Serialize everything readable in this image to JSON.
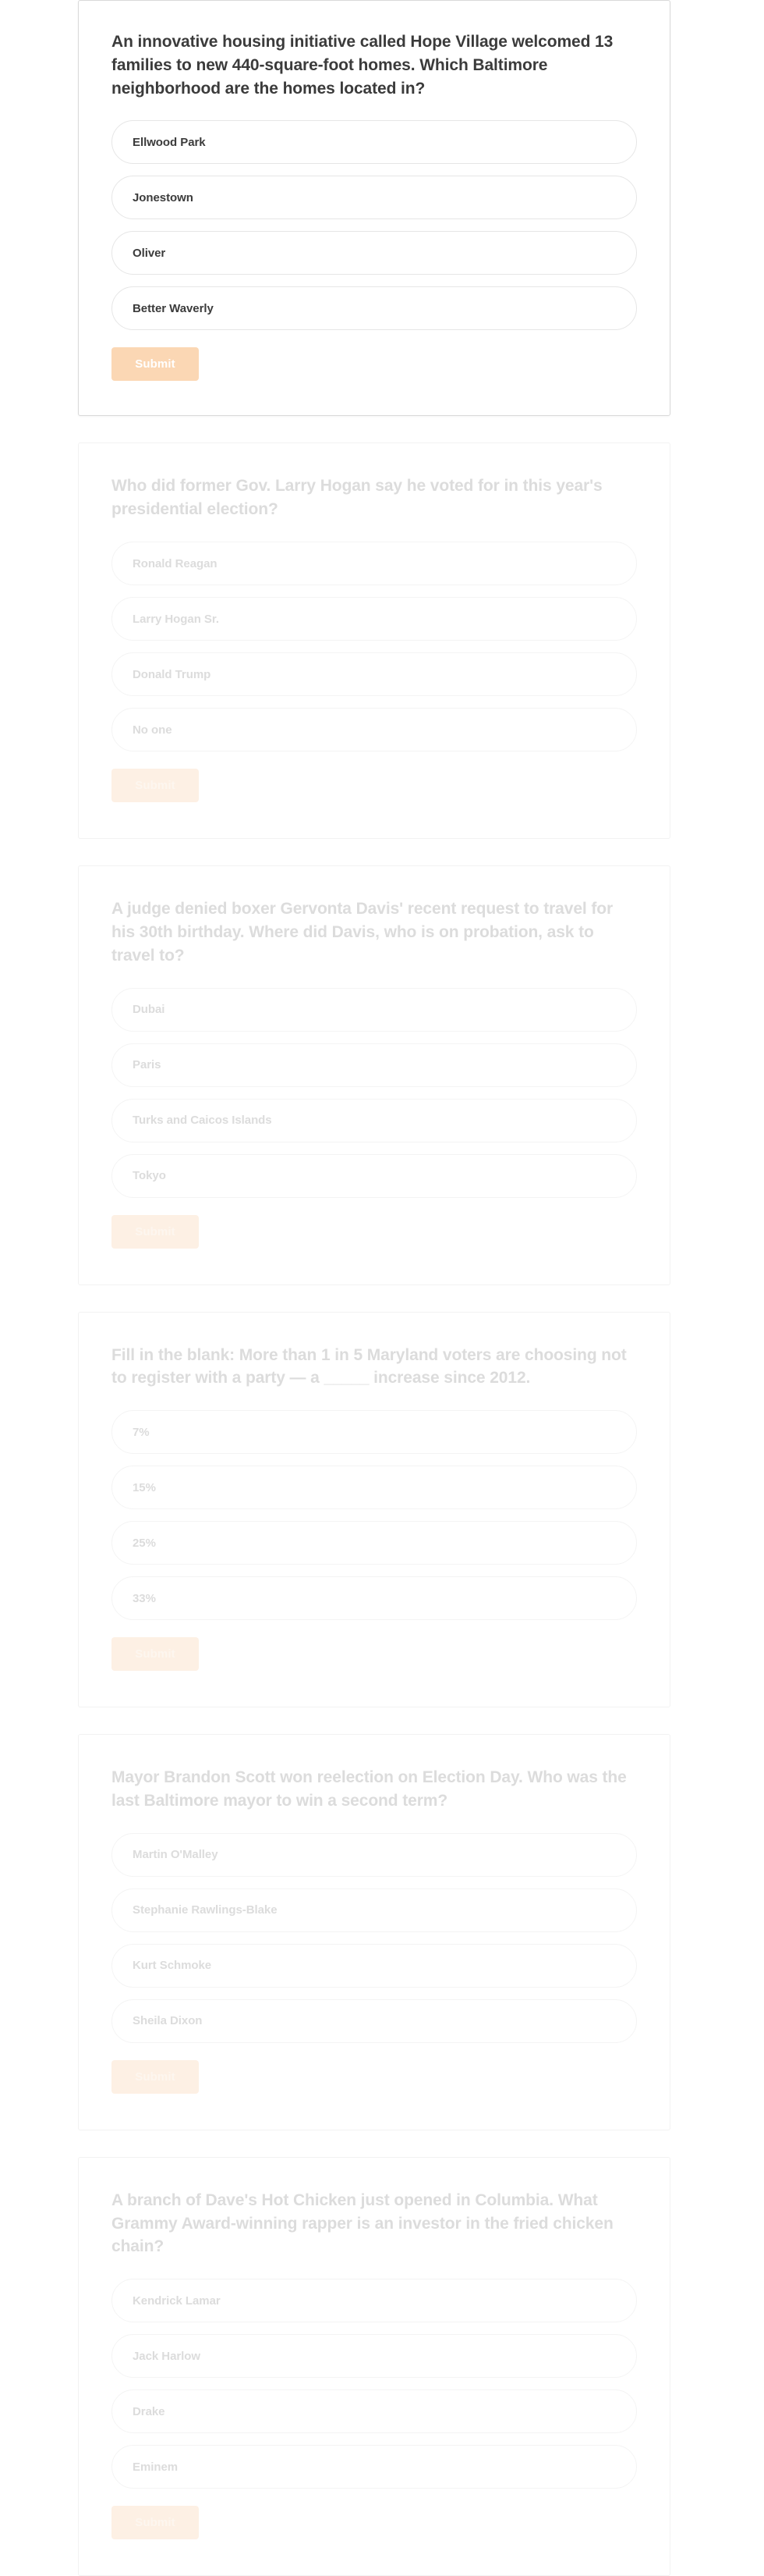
{
  "theme": {
    "page_background": "#ffffff",
    "card_background": "#ffffff",
    "card_border": "#e3e3e3",
    "question_color_active": "#3b3b3b",
    "question_color_faded": "#dcdcdc",
    "option_border_active": "#e6e6e6",
    "option_border_faded": "#f4f4f4",
    "submit_background_active": "#fbd7b4",
    "submit_background_faded": "#fdf0e4",
    "submit_text_color": "#ffffff"
  },
  "submit_label": "Submit",
  "questions": [
    {
      "id": "q1",
      "state": "active",
      "question": "An innovative housing initiative called Hope Village welcomed 13 families to new 440-square-foot homes. Which Baltimore neighborhood are the homes located in?",
      "options": [
        "Ellwood Park",
        "Jonestown",
        "Oliver",
        "Better Waverly"
      ],
      "submit_label": "Submit"
    },
    {
      "id": "q2",
      "state": "faded",
      "question": "Who did former Gov. Larry Hogan say he voted for in this year's presidential election?",
      "options": [
        "Ronald Reagan",
        "Larry Hogan Sr.",
        "Donald Trump",
        "No one"
      ],
      "submit_label": "Submit"
    },
    {
      "id": "q3",
      "state": "faded",
      "question": "A judge denied boxer Gervonta Davis' recent request to travel for his 30th birthday. Where did Davis, who is on probation, ask to travel to?",
      "options": [
        "Dubai",
        "Paris",
        "Turks and Caicos Islands",
        "Tokyo"
      ],
      "submit_label": "Submit"
    },
    {
      "id": "q4",
      "state": "faded",
      "question": "Fill in the blank: More than 1 in 5 Maryland voters are choosing not to register with a party — a _____ increase since 2012.",
      "options": [
        "7%",
        "15%",
        "25%",
        "33%"
      ],
      "submit_label": "Submit"
    },
    {
      "id": "q5",
      "state": "faded",
      "question": "Mayor Brandon Scott won reelection on Election Day. Who was the last Baltimore mayor to win a second term?",
      "options": [
        "Martin O'Malley",
        "Stephanie Rawlings-Blake",
        "Kurt Schmoke",
        "Sheila Dixon"
      ],
      "submit_label": "Submit"
    },
    {
      "id": "q6",
      "state": "faded",
      "question": "A branch of Dave's Hot Chicken just opened in Columbia. What Grammy Award-winning rapper is an investor in the fried chicken chain?",
      "options": [
        "Kendrick Lamar",
        "Jack Harlow",
        "Drake",
        "Eminem"
      ],
      "submit_label": "Submit"
    }
  ]
}
